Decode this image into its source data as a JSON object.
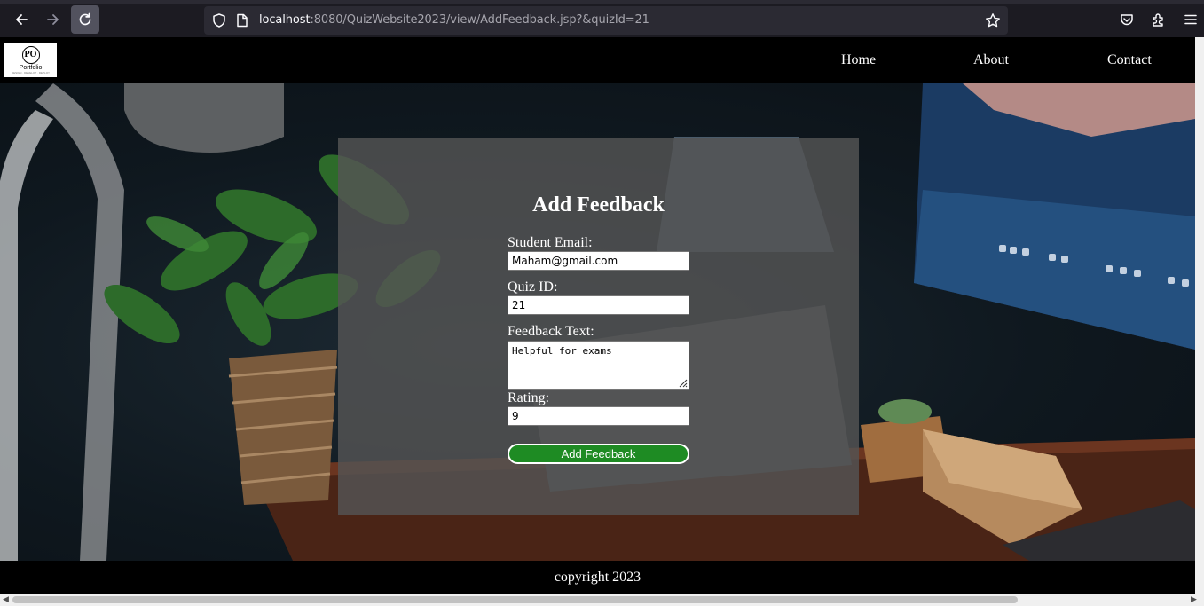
{
  "browser": {
    "url_host": "localhost",
    "url_rest": ":8080/QuizWebsite2023/view/AddFeedback.jsp?&quizId=21",
    "icons": [
      "back-arrow-icon",
      "forward-arrow-icon",
      "reload-icon",
      "shield-icon",
      "page-icon",
      "star-icon",
      "pocket-icon",
      "extensions-icon",
      "menu-icon"
    ]
  },
  "nav": {
    "logo_mark": "PO",
    "logo_word": "Portfolio",
    "logo_tag": "DESIGN · DEVELOP · DEPLOY",
    "links": [
      "Home",
      "About",
      "Contact"
    ]
  },
  "form": {
    "title": "Add Feedback",
    "email_label": "Student Email:",
    "email_value": "Maham@gmail.com",
    "quiz_label": "Quiz ID:",
    "quiz_value": "21",
    "text_label": "Feedback Text:",
    "text_value": "Helpful for exams",
    "rating_label": "Rating:",
    "rating_value": "9",
    "submit_label": "Add Feedback"
  },
  "footer": {
    "text": "copyright 2023"
  },
  "colors": {
    "navbar": "#000000",
    "card": "#545454",
    "button": "#1e8b23",
    "chrome": "#1c1b22"
  }
}
